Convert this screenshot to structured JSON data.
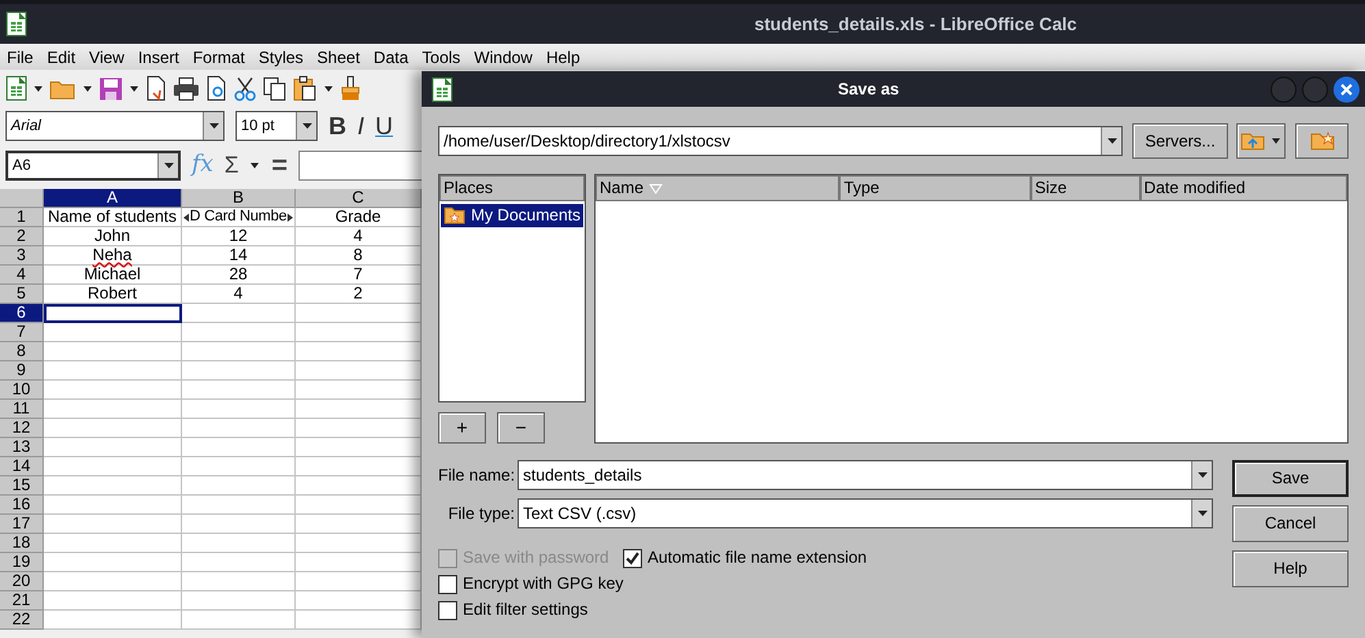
{
  "window": {
    "title": "students_details.xls - LibreOffice Calc"
  },
  "menu": [
    "File",
    "Edit",
    "View",
    "Insert",
    "Format",
    "Styles",
    "Sheet",
    "Data",
    "Tools",
    "Window",
    "Help"
  ],
  "formatting": {
    "font_name": "Arial",
    "font_size": "10 pt",
    "buttons": [
      "B",
      "I",
      "U"
    ]
  },
  "formula_bar": {
    "name_box": "A6",
    "function_wizard": "fx",
    "sum": "Σ",
    "formula": "="
  },
  "sheet": {
    "columns": [
      {
        "label": "A",
        "selected": true
      },
      {
        "label": "B",
        "selected": false
      },
      {
        "label": "C",
        "selected": false
      }
    ],
    "rows": [
      {
        "label": "1",
        "selected": false,
        "cells": [
          {
            "text": "Name of students",
            "clipped": false,
            "misspelled": false
          },
          {
            "text": "D Card Numbe",
            "clipped": true,
            "misspelled": false
          },
          {
            "text": "Grade",
            "clipped": false,
            "misspelled": false
          }
        ]
      },
      {
        "label": "2",
        "selected": false,
        "cells": [
          {
            "text": "John",
            "clipped": false,
            "misspelled": false
          },
          {
            "text": "12",
            "clipped": false,
            "misspelled": false
          },
          {
            "text": "4",
            "clipped": false,
            "misspelled": false
          }
        ]
      },
      {
        "label": "3",
        "selected": false,
        "cells": [
          {
            "text": "Neha",
            "clipped": false,
            "misspelled": true
          },
          {
            "text": "14",
            "clipped": false,
            "misspelled": false
          },
          {
            "text": "8",
            "clipped": false,
            "misspelled": false
          }
        ]
      },
      {
        "label": "4",
        "selected": false,
        "cells": [
          {
            "text": "Michael",
            "clipped": false,
            "misspelled": false
          },
          {
            "text": "28",
            "clipped": false,
            "misspelled": false
          },
          {
            "text": "7",
            "clipped": false,
            "misspelled": false
          }
        ]
      },
      {
        "label": "5",
        "selected": false,
        "cells": [
          {
            "text": "Robert",
            "clipped": false,
            "misspelled": false
          },
          {
            "text": "4",
            "clipped": false,
            "misspelled": false
          },
          {
            "text": "2",
            "clipped": false,
            "misspelled": false
          }
        ]
      },
      {
        "label": "6",
        "selected": true
      },
      {
        "label": "7",
        "selected": false
      },
      {
        "label": "8",
        "selected": false
      },
      {
        "label": "9",
        "selected": false
      },
      {
        "label": "10",
        "selected": false
      },
      {
        "label": "11",
        "selected": false
      },
      {
        "label": "12",
        "selected": false
      },
      {
        "label": "13",
        "selected": false
      },
      {
        "label": "14",
        "selected": false
      },
      {
        "label": "15",
        "selected": false
      },
      {
        "label": "16",
        "selected": false
      },
      {
        "label": "17",
        "selected": false
      },
      {
        "label": "18",
        "selected": false
      },
      {
        "label": "19",
        "selected": false
      },
      {
        "label": "20",
        "selected": false
      },
      {
        "label": "21",
        "selected": false
      },
      {
        "label": "22",
        "selected": false
      }
    ]
  },
  "dialog": {
    "title": "Save as",
    "path": "/home/user/Desktop/directory1/xlstocsv",
    "servers_button": "Servers...",
    "places": {
      "header": "Places",
      "items": [
        {
          "label": "My Documents",
          "selected": true
        }
      ],
      "add_button": "+",
      "remove_button": "−"
    },
    "file_list": {
      "columns": [
        {
          "label": "Name",
          "sorted": true
        },
        {
          "label": "Type",
          "sorted": false
        },
        {
          "label": "Size",
          "sorted": false
        },
        {
          "label": "Date modified",
          "sorted": false
        }
      ]
    },
    "file_name": {
      "label": "File name:",
      "value": "students_details"
    },
    "file_type": {
      "label": "File type:",
      "value": "Text CSV (.csv)"
    },
    "buttons": [
      {
        "label": "Save",
        "default": true
      },
      {
        "label": "Cancel",
        "default": false
      },
      {
        "label": "Help",
        "default": false
      }
    ],
    "options": [
      {
        "label": "Save with password",
        "checked": false,
        "disabled": true
      },
      {
        "label": "Automatic file name extension",
        "checked": true,
        "disabled": false
      },
      {
        "label": "Encrypt with GPG key",
        "checked": false,
        "disabled": false
      },
      {
        "label": "Edit filter settings",
        "checked": false,
        "disabled": false
      }
    ]
  }
}
